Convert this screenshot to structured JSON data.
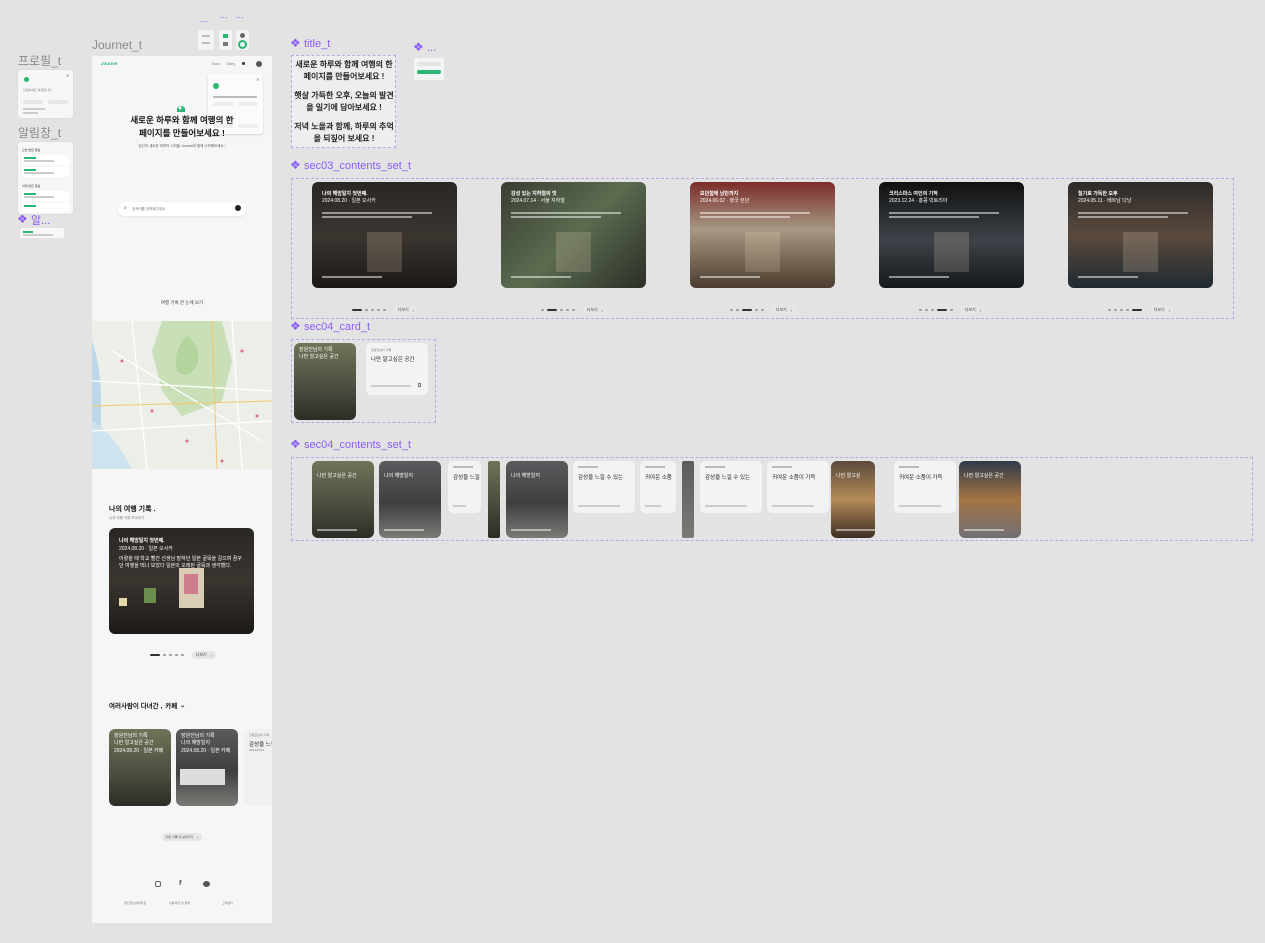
{
  "canvas": {
    "left_frames": {
      "profile_label": "프로필_t",
      "alarm_label": "알림창_t",
      "small_label": "알...",
      "profile_popup": {
        "title": "안녕하세요 여정입니다."
      },
      "alarm_popup": {
        "heading1": "오늘 받은 알림",
        "heading2": "어제 받은 알림"
      }
    },
    "top_dots": [
      "...",
      "...",
      "..."
    ],
    "journet_label": "Journet_t",
    "title_t": {
      "label": "title_t",
      "lines": [
        "새로운 하루와 함께 여행의 한 페이지를 만들어보세요 !",
        "햇살 가득한 오후, 오늘의 발견을 일기에 담아보세요 !",
        "저녁 노을과 함께, 하루의 추억을 되짚어 보세요 !"
      ]
    },
    "small_comp_label": "...",
    "sec03_label": "sec03_contents_set_t",
    "sec04_card_label": "sec04_card_t",
    "sec04_set_label": "sec04_contents_set_t"
  },
  "app": {
    "logo": "Journet",
    "nav": [
      "Sora",
      "Diary"
    ],
    "hero_title_line1": "새로운 하루와 함께 여행의 한",
    "hero_title_line2": "페이지를 만들어보세요 !",
    "hero_subtitle": "당신의 새로운 하루의 시작을 Journet과 함께 시작해보세요 !",
    "search_placeholder": "검색어를 입력해주세요",
    "map_caption": "여행 기록 한 눈에 보기",
    "my_records_title": "나의 여행 기록 .",
    "my_records_sub": "나의 여행 기록 모아보기",
    "featured_card": {
      "title": "나의 해방일지 첫번째.",
      "date": "2024.08.20 · 일본 오사카",
      "body": "어렸을 때 학교 빨간 선생님 말하던 일본 골목을 걸으며 꿈꾸던 여행을 떠나 보았다 일본의 오래된 골목과 생각했다."
    },
    "more_button": "더보기",
    "others_title": "여러사람이 다녀간 ,",
    "others_category": "카페",
    "small_cards": [
      {
        "tag": "장원진님의 기록",
        "title": "나만 알고싶은 공간",
        "sub": "2024.08.20 · 일본 카페"
      },
      {
        "tag": "장원진님의 기록",
        "title": "나의 해방일지",
        "sub": "2024.08.20 · 일본 카페"
      },
      {
        "tag": "장원진님의 기록",
        "title": "감성을 느낄",
        "sub": "2024.08.20"
      }
    ],
    "others_more_button": "다른 기록 더 보러가기",
    "footer_links": [
      "개인정보처리방침",
      "이용약관 및 정책",
      "고객센터"
    ]
  },
  "sec03_cards": [
    {
      "title": "나의 해방일지 첫번째.",
      "date": "2024.08.20 · 일본 오사카"
    },
    {
      "title": "감성 있는 지하철의 멋",
      "date": "2024.07.14 · 서울 지하철"
    },
    {
      "title": "모던함에 낭만까지",
      "date": "2024.06.02 · 영국 런던"
    },
    {
      "title": "크리스마스 여인의 기적",
      "date": "2023.12.24 · 홍콩 빅토리아"
    },
    {
      "title": "칠기로 가득한 오후",
      "date": "2024.05.11 · 베트남 다낭"
    }
  ],
  "sec03_more": "더보기",
  "sec04_card_pair": [
    {
      "tag": "장원진님의 기록",
      "title": "나만 알고싶은 공간"
    },
    {
      "tag": "장원진님의 기록",
      "title": "나만 알고싶은 공간"
    }
  ],
  "sec04_items": [
    {
      "title": "나만 알고싶은 공간"
    },
    {
      "title": "나의 해방일지"
    },
    {
      "title": "감성을 느낄"
    },
    {
      "title": "나의 해방일지"
    },
    {
      "title": "감성을 느낄 수 있는"
    },
    {
      "title": "귀여운 소품"
    },
    {
      "title": "감성을 느낄 수 있는"
    },
    {
      "title": "귀여운 소품이 가득"
    },
    {
      "title": "나만 알고싶"
    },
    {
      "title": "귀여운 소품이 가득"
    },
    {
      "title": "나만 알고싶은 공간"
    }
  ],
  "colors": {
    "accent": "#2bb673",
    "canvas_bg": "#e3e3e3",
    "component_purple": "#8b5cf6"
  }
}
